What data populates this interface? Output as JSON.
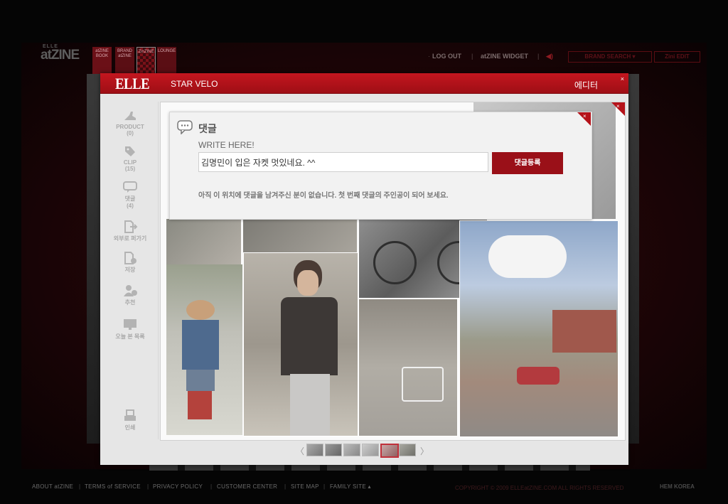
{
  "site": {
    "logo": "atZINE",
    "logo_small": "ELLE"
  },
  "top_tabs": [
    "atZINE BOOK",
    "BRAND atZINE",
    "ZinZINE",
    "LOUNGE"
  ],
  "top_nav": {
    "logout": "LOG OUT",
    "widget": "atZINE WIDGET",
    "brand_search": "BRAND SEARCH ▾",
    "zini_edit": "Zini EDIT"
  },
  "modal": {
    "brand": "ELLE",
    "title": "STAR VELO",
    "editor": "에디터",
    "close": "×"
  },
  "sidebar": [
    {
      "label": "PRODUCT",
      "count": "(0)",
      "icon": "shoe-icon"
    },
    {
      "label": "CLIP",
      "count": "(15)",
      "icon": "tag-icon"
    },
    {
      "label": "댓글",
      "count": "(4)",
      "icon": "comment-icon"
    },
    {
      "label": "외부로 퍼가기",
      "count": "",
      "icon": "export-icon"
    },
    {
      "label": "저장",
      "count": "",
      "icon": "save-icon"
    },
    {
      "label": "추천",
      "count": "",
      "icon": "recommend-icon"
    },
    {
      "label": "오늘 본 목록",
      "count": "",
      "icon": "monitor-icon"
    },
    {
      "label": "인쇄",
      "count": "",
      "icon": "print-icon"
    }
  ],
  "comment": {
    "title": "댓글",
    "write_label": "WRITE HERE!",
    "input_value": "김명민이 입은 자켓 멋있네요. ^^",
    "submit": "댓글등록",
    "notice": "아직 이 위치에 댓글을 남겨주신 분이 없습니다. 첫 번째 댓글의 주인공이 되어 보세요."
  },
  "thumbnails": {
    "prev": "〈",
    "next": "〉",
    "count": 6,
    "active_index": 4
  },
  "footer": {
    "links": [
      "ABOUT atZINE",
      "TERMS of SERVICE",
      "PRIVACY POLICY",
      "CUSTOMER CENTER",
      "SITE MAP",
      "FAMILY SITE ▴"
    ],
    "copyright": "COPYRIGHT © 2009 ELLEatZINE.COM ALL RIGHTS RESERVED",
    "company": "HEM KOREA"
  },
  "colors": {
    "accent": "#b51219",
    "modal_bg": "#e6e6e6"
  }
}
